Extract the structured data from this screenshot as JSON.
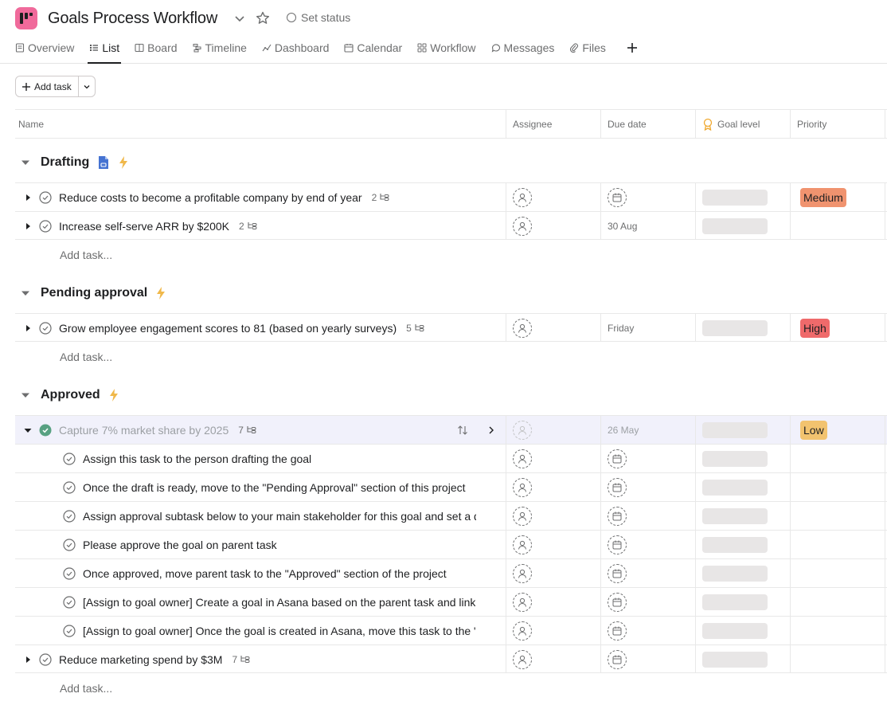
{
  "project": {
    "title": "Goals Process Workflow",
    "set_status": "Set status",
    "icon_color": "#f06a9b"
  },
  "tabs": [
    {
      "label": "Overview",
      "icon": "overview-icon"
    },
    {
      "label": "List",
      "icon": "list-icon",
      "active": true
    },
    {
      "label": "Board",
      "icon": "board-icon"
    },
    {
      "label": "Timeline",
      "icon": "timeline-icon"
    },
    {
      "label": "Dashboard",
      "icon": "dashboard-icon"
    },
    {
      "label": "Calendar",
      "icon": "calendar-icon"
    },
    {
      "label": "Workflow",
      "icon": "workflow-icon"
    },
    {
      "label": "Messages",
      "icon": "messages-icon"
    },
    {
      "label": "Files",
      "icon": "files-icon"
    }
  ],
  "toolbar": {
    "add_task": "Add task"
  },
  "columns": {
    "name": "Name",
    "assignee": "Assignee",
    "due_date": "Due date",
    "goal_level": "Goal level",
    "priority": "Priority"
  },
  "add_task_link": "Add task...",
  "sections": {
    "drafting": {
      "title": "Drafting",
      "tasks": [
        {
          "name": "Reduce costs to become a profitable company by end of year",
          "subtasks": "2",
          "due": "",
          "priority": "Medium"
        },
        {
          "name": "Increase self-serve ARR by $200K",
          "subtasks": "2",
          "due": "30 Aug",
          "priority": ""
        }
      ]
    },
    "pending": {
      "title": "Pending approval",
      "tasks": [
        {
          "name": "Grow employee engagement scores to 81 (based on yearly surveys)",
          "subtasks": "5",
          "due": "Friday",
          "priority": "High"
        }
      ]
    },
    "approved": {
      "title": "Approved",
      "tasks": [
        {
          "name": "Capture 7% market share by 2025",
          "subtasks": "7",
          "due": "26 May",
          "priority": "Low"
        },
        {
          "name": "Reduce marketing spend by $3M",
          "subtasks": "7",
          "due": "",
          "priority": ""
        }
      ],
      "subtasks": [
        "Assign this task to the person drafting the goal",
        "Once the draft is ready, move to the \"Pending Approval\" section of this project",
        "Assign approval subtask below to your main stakeholder for this goal and set a d",
        "Please approve the goal on parent task",
        "Once approved, move parent task to the \"Approved\" section of the project",
        "[Assign to goal owner] Create a goal in Asana based on the parent task and link",
        "[Assign to goal owner] Once the goal is created in Asana, move this task to the \""
      ]
    }
  }
}
